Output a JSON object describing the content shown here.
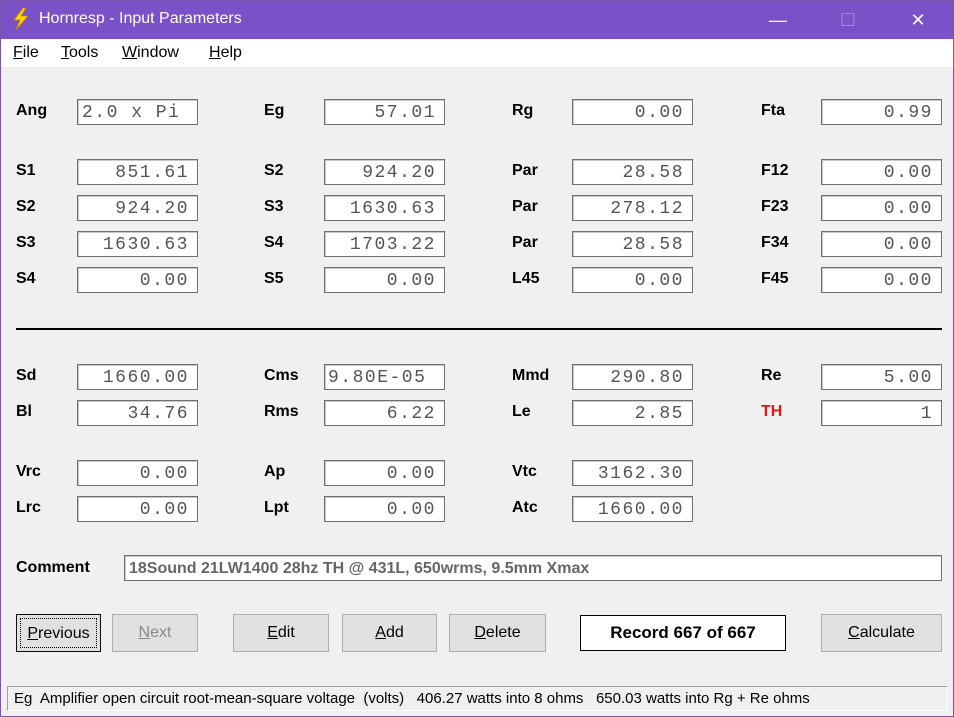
{
  "window": {
    "title": "Hornresp - Input Parameters",
    "min_glyph": "—",
    "max_glyph": "☐",
    "close_glyph": "✕",
    "icon": "lightning-bolt-icon"
  },
  "menu": [
    {
      "accel": "F",
      "rest": "ile"
    },
    {
      "accel": "T",
      "rest": "ools"
    },
    {
      "accel": "W",
      "rest": "indow"
    },
    {
      "accel": "H",
      "rest": "elp"
    }
  ],
  "params": {
    "ang": {
      "label": "Ang",
      "value": "2.0 x Pi"
    },
    "eg": {
      "label": "Eg",
      "value": "57.01"
    },
    "rg": {
      "label": "Rg",
      "value": "0.00"
    },
    "fta": {
      "label": "Fta",
      "value": "0.99"
    },
    "s1": {
      "label": "S1",
      "value": "851.61"
    },
    "s2a": {
      "label": "S2",
      "value": "924.20"
    },
    "par1": {
      "label": "Par",
      "value": "28.58"
    },
    "f12": {
      "label": "F12",
      "value": "0.00"
    },
    "s2b": {
      "label": "S2",
      "value": "924.20"
    },
    "s3a": {
      "label": "S3",
      "value": "1630.63"
    },
    "par2": {
      "label": "Par",
      "value": "278.12"
    },
    "f23": {
      "label": "F23",
      "value": "0.00"
    },
    "s3b": {
      "label": "S3",
      "value": "1630.63"
    },
    "s4a": {
      "label": "S4",
      "value": "1703.22"
    },
    "par3": {
      "label": "Par",
      "value": "28.58"
    },
    "f34": {
      "label": "F34",
      "value": "0.00"
    },
    "s4b": {
      "label": "S4",
      "value": "0.00"
    },
    "s5": {
      "label": "S5",
      "value": "0.00"
    },
    "l45": {
      "label": "L45",
      "value": "0.00"
    },
    "f45": {
      "label": "F45",
      "value": "0.00"
    },
    "sd": {
      "label": "Sd",
      "value": "1660.00"
    },
    "cms": {
      "label": "Cms",
      "value": "9.80E-05"
    },
    "mmd": {
      "label": "Mmd",
      "value": "290.80"
    },
    "re": {
      "label": "Re",
      "value": "5.00"
    },
    "bl": {
      "label": "Bl",
      "value": "34.76"
    },
    "rms": {
      "label": "Rms",
      "value": "6.22"
    },
    "le": {
      "label": "Le",
      "value": "2.85"
    },
    "th": {
      "label": "TH",
      "value": "1"
    },
    "vrc": {
      "label": "Vrc",
      "value": "0.00"
    },
    "ap": {
      "label": "Ap",
      "value": "0.00"
    },
    "vtc": {
      "label": "Vtc",
      "value": "3162.30"
    },
    "lrc": {
      "label": "Lrc",
      "value": "0.00"
    },
    "lpt": {
      "label": "Lpt",
      "value": "0.00"
    },
    "atc": {
      "label": "Atc",
      "value": "1660.00"
    }
  },
  "comment": {
    "label": "Comment",
    "value": "18Sound 21LW1400 28hz TH @ 431L, 650wrms, 9.5mm Xmax"
  },
  "buttons": {
    "previous": {
      "accel": "P",
      "rest": "revious"
    },
    "next": {
      "accel": "N",
      "rest": "ext"
    },
    "edit": {
      "accel": "E",
      "rest": "dit"
    },
    "add": {
      "accel": "A",
      "rest": "dd"
    },
    "delete": {
      "accel": "D",
      "rest": "elete"
    },
    "calculate": {
      "accel": "C",
      "rest": "alculate"
    }
  },
  "record": "Record 667 of 667",
  "status": "Eg  Amplifier open circuit root-mean-square voltage  (volts)   406.27 watts into 8 ohms   650.03 watts into Rg + Re ohms",
  "colors": {
    "titlebar": "#7b51c7",
    "th_label": "#e8171b"
  }
}
